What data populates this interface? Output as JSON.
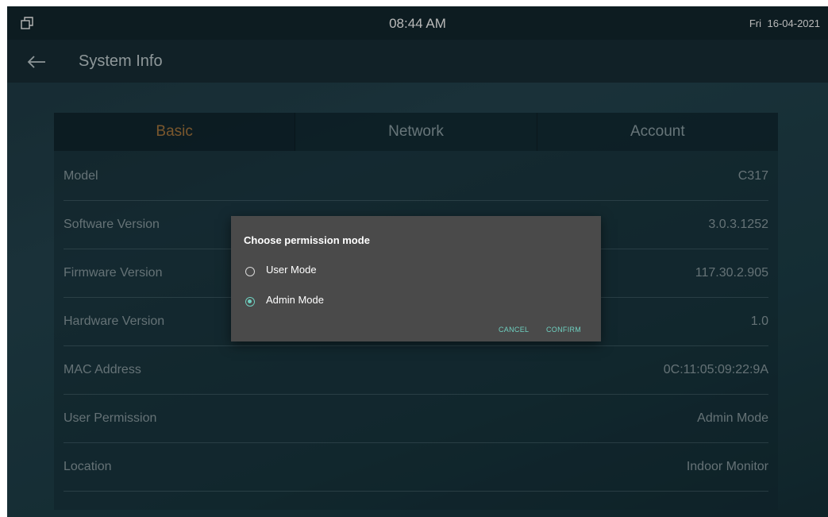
{
  "status_bar": {
    "icon": "window-restore-icon",
    "time": "08:44 AM",
    "day": "Fri",
    "date": "16-04-2021"
  },
  "header": {
    "back_icon": "arrow-left-icon",
    "title": "System Info"
  },
  "tabs": [
    {
      "label": "Basic",
      "active": true
    },
    {
      "label": "Network",
      "active": false
    },
    {
      "label": "Account",
      "active": false
    }
  ],
  "info_rows": [
    {
      "label": "Model",
      "value": "C317"
    },
    {
      "label": "Software Version",
      "value": "3.0.3.1252"
    },
    {
      "label": "Firmware Version",
      "value": "117.30.2.905"
    },
    {
      "label": "Hardware Version",
      "value": "1.0"
    },
    {
      "label": "MAC Address",
      "value": "0C:11:05:09:22:9A"
    },
    {
      "label": "User Permission",
      "value": "Admin Mode"
    },
    {
      "label": "Location",
      "value": "Indoor Monitor"
    }
  ],
  "dialog": {
    "title": "Choose permission mode",
    "options": [
      {
        "label": "User Mode",
        "selected": false
      },
      {
        "label": "Admin Mode",
        "selected": true
      }
    ],
    "cancel_label": "CANCEL",
    "confirm_label": "CONFIRM"
  },
  "colors": {
    "active_tab": "#a9793f",
    "accent": "#6fd0c0",
    "dialog_bg": "#4a4a4a",
    "status_bar_bg": "#12272e"
  }
}
